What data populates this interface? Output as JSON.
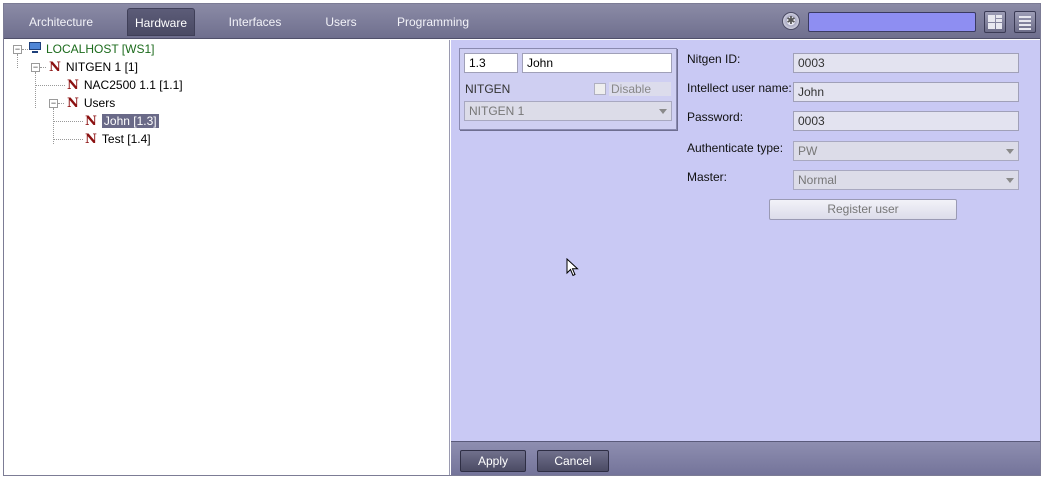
{
  "topbar": {
    "tabs": [
      {
        "label": "Architecture",
        "active": false
      },
      {
        "label": "Hardware",
        "active": true
      },
      {
        "label": "Interfaces",
        "active": false
      },
      {
        "label": "Users",
        "active": false
      },
      {
        "label": "Programming",
        "active": false
      }
    ],
    "search_value": "",
    "icons": [
      "settings-wheel-icon",
      "layout-grid-icon",
      "menu-list-icon"
    ]
  },
  "tree": {
    "items": [
      {
        "label": "LOCALHOST [WS1]",
        "icon": "computer-icon"
      },
      {
        "label": "NITGEN 1 [1]",
        "icon": "nitgen-icon"
      },
      {
        "label": "NAC2500 1.1 [1.1]",
        "icon": "nitgen-icon"
      },
      {
        "label": "Users",
        "icon": "nitgen-icon"
      },
      {
        "label": "John [1.3]",
        "icon": "nitgen-icon",
        "selected": true
      },
      {
        "label": "Test [1.4]",
        "icon": "nitgen-icon"
      }
    ],
    "n_glyph": "N"
  },
  "object_panel": {
    "id_value": "1.3",
    "name_value": "John",
    "type_label": "NITGEN",
    "disable_label": "Disable",
    "disable_checked": false,
    "parent_select": "NITGEN 1"
  },
  "settings": {
    "nitgen_id_label": "Nitgen ID:",
    "nitgen_id_value": "0003",
    "intellect_user_label": "Intellect user name:",
    "intellect_user_value": "John",
    "password_label": "Password:",
    "password_value": "0003",
    "auth_type_label": "Authenticate type:",
    "auth_type_value": "PW",
    "master_label": "Master:",
    "master_value": "Normal",
    "register_button": "Register user"
  },
  "footer": {
    "apply_label": "Apply",
    "cancel_label": "Cancel"
  },
  "colors": {
    "pane_bg": "#c9c9f4",
    "topbar_bg": "#7d7d9a",
    "search_bg": "#8e8ef2",
    "node_icon": "#8b1010",
    "host_text": "#1c6b1c"
  }
}
